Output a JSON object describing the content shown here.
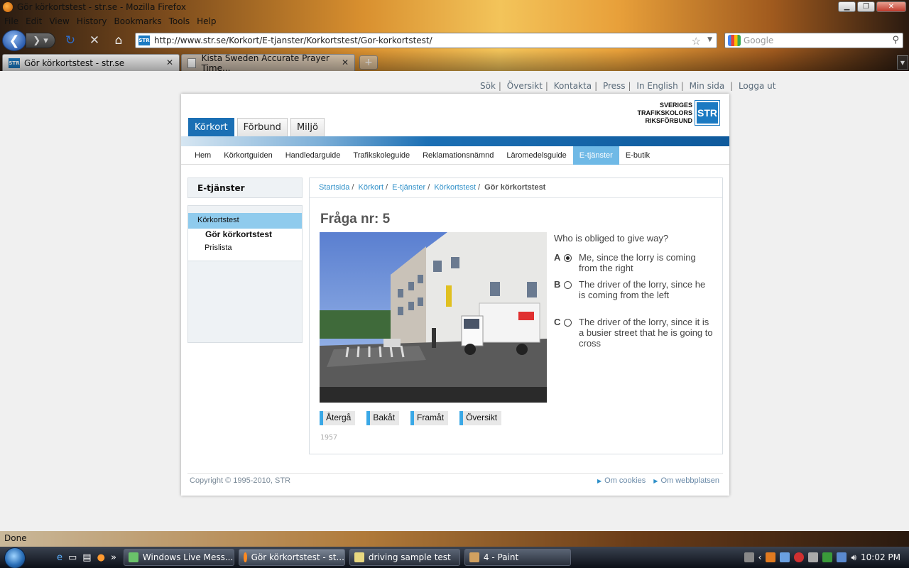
{
  "window": {
    "title": "Gör körkortstest - str.se - Mozilla Firefox"
  },
  "menu": [
    "File",
    "Edit",
    "View",
    "History",
    "Bookmarks",
    "Tools",
    "Help"
  ],
  "nav": {
    "url": "http://www.str.se/Korkort/E-tjanster/Korkortstest/Gor-korkortstest/",
    "search_placeholder": "Google"
  },
  "tabs": [
    {
      "title": "Gör körkortstest - str.se",
      "active": true
    },
    {
      "title": "Kista Sweden Accurate Prayer Time...",
      "active": false
    }
  ],
  "top_links": [
    "Sök",
    "Översikt",
    "Kontakta",
    "Press",
    "In English",
    "Min sida",
    "Logga ut"
  ],
  "logo": {
    "line1": "SVERIGES",
    "line2": "TRAFIKSKOLORS",
    "line3": "RIKSFÖRBUND",
    "mark": "STR"
  },
  "main_tabs": [
    "Körkort",
    "Förbund",
    "Miljö"
  ],
  "sub_nav": [
    "Hem",
    "Körkortguiden",
    "Handledarguide",
    "Trafikskoleguide",
    "Reklamationsnämnd",
    "Läromedelsguide",
    "E-tjänster",
    "E-butik"
  ],
  "sidebar": {
    "heading": "E-tjänster",
    "items": [
      "Körkortstest",
      "Gör körkortstest",
      "Prislista"
    ]
  },
  "breadcrumb": {
    "links": [
      "Startsida",
      "Körkort",
      "E-tjänster",
      "Körkortstest"
    ],
    "current": "Gör körkortstest"
  },
  "question": {
    "title": "Fråga nr: 5",
    "text": "Who is obliged to give way?",
    "options": [
      {
        "letter": "A",
        "text": "Me, since the lorry is coming from the right",
        "selected": true
      },
      {
        "letter": "B",
        "text": "The driver of the lorry, since he is coming from the left",
        "selected": false
      },
      {
        "letter": "C",
        "text": "The driver of the lorry, since it is a busier street that he is going to cross",
        "selected": false
      }
    ],
    "buttons": [
      "Återgå",
      "Bakåt",
      "Framåt",
      "Översikt"
    ],
    "id": "1957"
  },
  "footer": {
    "copyright": "Copyright © 1995-2010, STR",
    "links": [
      "Om cookies",
      "Om webbplatsen"
    ]
  },
  "status": "Done",
  "taskbar": {
    "buttons": [
      "Windows Live Mess...",
      "Gör körkortstest - st...",
      "driving sample test",
      "4 - Paint"
    ],
    "clock": "10:02 PM"
  },
  "colors": {
    "accent": "#1b6fb4",
    "highlight": "#6fb9e6",
    "link": "#2e8fc8"
  }
}
